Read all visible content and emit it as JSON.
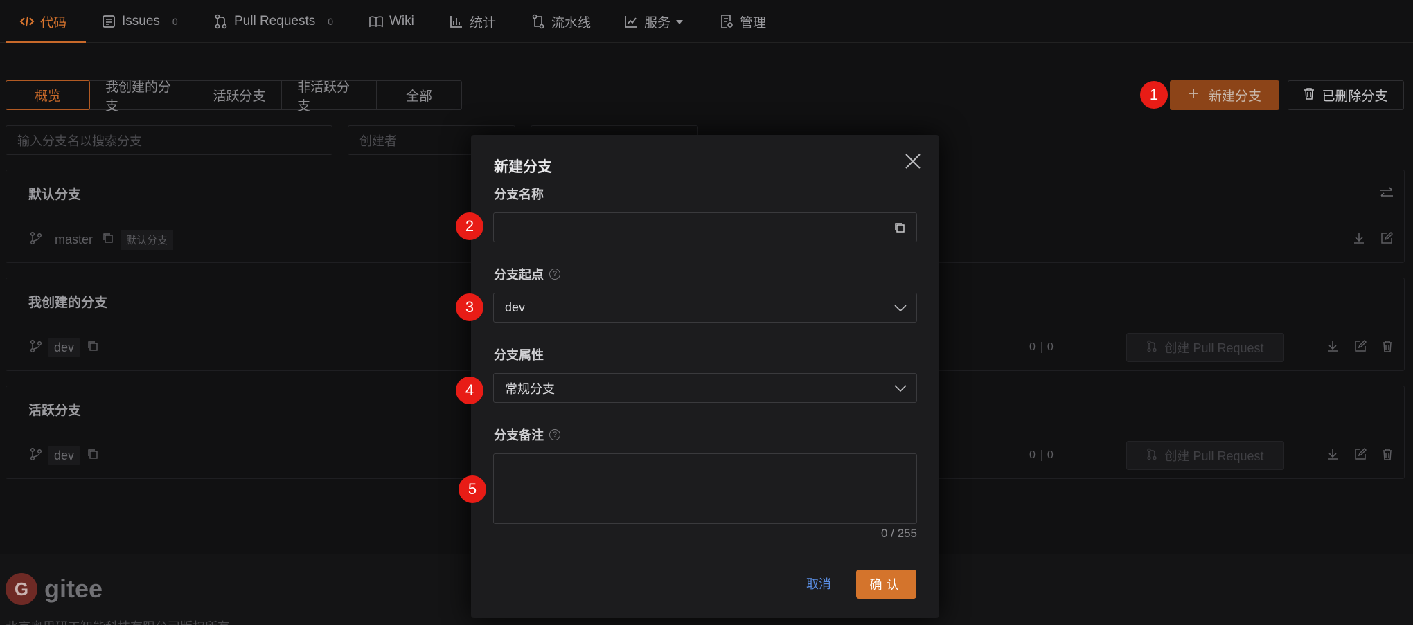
{
  "nav": {
    "items": [
      {
        "label": "代码",
        "icon": "code-icon"
      },
      {
        "label": "Issues",
        "count": "0",
        "icon": "issues-icon"
      },
      {
        "label": "Pull Requests",
        "count": "0",
        "icon": "pull-request-icon"
      },
      {
        "label": "Wiki",
        "icon": "book-icon"
      },
      {
        "label": "统计",
        "icon": "bar-chart-icon"
      },
      {
        "label": "流水线",
        "icon": "pipeline-icon"
      },
      {
        "label": "服务",
        "icon": "line-chart-icon"
      },
      {
        "label": "管理",
        "icon": "settings-doc-icon"
      }
    ]
  },
  "tabs": [
    "概览",
    "我创建的分支",
    "活跃分支",
    "非活跃分支",
    "全部"
  ],
  "actions": {
    "new_branch": "新建分支",
    "deleted_branches": "已删除分支"
  },
  "filters": {
    "search_placeholder": "输入分支名以搜索分支",
    "creator_placeholder": "创建者"
  },
  "sections": {
    "default": {
      "title": "默认分支",
      "branch": "master",
      "badge": "默认分支"
    },
    "mine": {
      "title": "我创建的分支",
      "branch": "dev",
      "ahead": "0",
      "behind": "0",
      "pr_label": "创建 Pull Request"
    },
    "active": {
      "title": "活跃分支",
      "branch": "dev",
      "ahead": "0",
      "behind": "0",
      "pr_label": "创建 Pull Request"
    }
  },
  "footer": {
    "logo_text": "gitee",
    "copyright": "北京奥思研工智能科技有限公司版权所有"
  },
  "modal": {
    "title": "新建分支",
    "name_label": "分支名称",
    "name_value": "",
    "source_label": "分支起点",
    "source_value": "dev",
    "type_label": "分支属性",
    "type_value": "常规分支",
    "note_label": "分支备注",
    "note_counter": "0 / 255",
    "cancel": "取消",
    "confirm": "确认"
  },
  "markers": [
    "1",
    "2",
    "3",
    "4",
    "5"
  ],
  "colors": {
    "accent": "#d4742c",
    "marker": "#e81c16",
    "link": "#5a8de0"
  }
}
